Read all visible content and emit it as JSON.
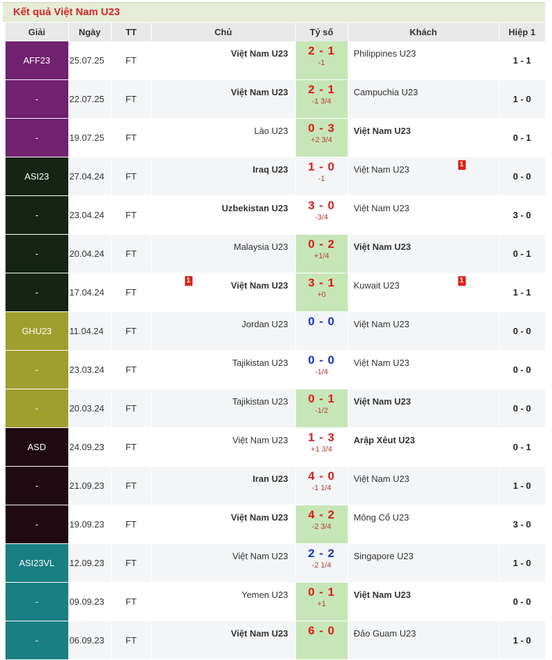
{
  "title": "Kết quả Việt Nam U23",
  "headers": {
    "league": "Giải",
    "date": "Ngày",
    "status": "TT",
    "home": "Chủ",
    "score": "Tỷ số",
    "away": "Khách",
    "half": "Hiệp 1"
  },
  "colors": {
    "AFF23": "#70216f",
    "ASI23": "#152415",
    "GHU23": "#9f9f2f",
    "ASD": "#200a12",
    "ASI23VL": "#1a7f82"
  },
  "rows": [
    {
      "league": "AFF23",
      "date": "25.07.25",
      "status": "FT",
      "home": "Việt Nam U23",
      "score": "2 - 1",
      "handicap": "-1",
      "away": "Philippines U23",
      "half": "1 - 1"
    },
    {
      "league": "-",
      "date": "22.07.25",
      "status": "FT",
      "home": "Việt Nam U23",
      "score": "2 - 1",
      "handicap": "-1 3/4",
      "away": "Campuchia U23",
      "half": "1 - 0"
    },
    {
      "league": "-",
      "date": "19.07.25",
      "status": "FT",
      "home": "Lào U23",
      "score": "0 - 3",
      "handicap": "+2 3/4",
      "away": "Việt Nam U23",
      "half": "0 - 1"
    },
    {
      "league": "ASI23",
      "date": "27.04.24",
      "status": "FT",
      "home": "Iraq U23",
      "score": "1 - 0",
      "handicap": "-1",
      "away": "Việt Nam U23",
      "half": "0 - 0",
      "away_card": "1"
    },
    {
      "league": "-",
      "date": "23.04.24",
      "status": "FT",
      "home": "Uzbekistan U23",
      "score": "3 - 0",
      "handicap": "-3/4",
      "away": "Việt Nam U23",
      "half": "3 - 0"
    },
    {
      "league": "-",
      "date": "20.04.24",
      "status": "FT",
      "home": "Malaysia U23",
      "score": "0 - 2",
      "handicap": "+1/4",
      "away": "Việt Nam U23",
      "half": "0 - 1"
    },
    {
      "league": "-",
      "date": "17.04.24",
      "status": "FT",
      "home": "Việt Nam U23",
      "score": "3 - 1",
      "handicap": "+0",
      "away": "Kuwait U23",
      "half": "1 - 1",
      "home_card": "1",
      "away_card": "1"
    },
    {
      "league": "GHU23",
      "date": "11.04.24",
      "status": "FT",
      "home": "Jordan U23",
      "score": "0 - 0",
      "handicap": "",
      "away": "Việt Nam U23",
      "half": "0 - 0"
    },
    {
      "league": "-",
      "date": "23.03.24",
      "status": "FT",
      "home": "Tajikistan U23",
      "score": "0 - 0",
      "handicap": "-1/4",
      "away": "Việt Nam U23",
      "half": "0 - 0"
    },
    {
      "league": "-",
      "date": "20.03.24",
      "status": "FT",
      "home": "Tajikistan U23",
      "score": "0 - 1",
      "handicap": "-1/2",
      "away": "Việt Nam U23",
      "half": "0 - 0"
    },
    {
      "league": "ASD",
      "date": "24.09.23",
      "status": "FT",
      "home": "Việt Nam U23",
      "score": "1 - 3",
      "handicap": "+1 3/4",
      "away": "Arập Xêut U23",
      "half": "0 - 1"
    },
    {
      "league": "-",
      "date": "21.09.23",
      "status": "FT",
      "home": "Iran U23",
      "score": "4 - 0",
      "handicap": "-1 1/4",
      "away": "Việt Nam U23",
      "half": "1 - 0"
    },
    {
      "league": "-",
      "date": "19.09.23",
      "status": "FT",
      "home": "Việt Nam U23",
      "score": "4 - 2",
      "handicap": "-2 3/4",
      "away": "Mông Cổ U23",
      "half": "3 - 0"
    },
    {
      "league": "ASI23VL",
      "date": "12.09.23",
      "status": "FT",
      "home": "Việt Nam U23",
      "score": "2 - 2",
      "handicap": "-2 1/4",
      "away": "Singapore U23",
      "half": "1 - 0"
    },
    {
      "league": "-",
      "date": "09.09.23",
      "status": "FT",
      "home": "Yemen U23",
      "score": "0 - 1",
      "handicap": "+1",
      "away": "Việt Nam U23",
      "half": "0 - 0"
    },
    {
      "league": "-",
      "date": "06.09.23",
      "status": "FT",
      "home": "Việt Nam U23",
      "score": "6 - 0",
      "handicap": "",
      "away": "Đảo Guam U23",
      "half": "1 - 0"
    }
  ]
}
